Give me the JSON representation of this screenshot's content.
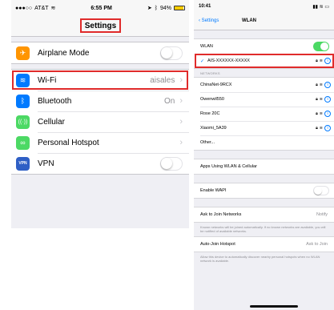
{
  "left": {
    "status": {
      "carrier": "AT&T",
      "signal_dots": "●●●○○",
      "time": "6:55 PM",
      "battery": "94%"
    },
    "nav_title": "Settings",
    "group1": [
      {
        "label": "Airplane Mode",
        "icon": "airplane-icon",
        "color": "#ff9500",
        "glyph": "✈"
      }
    ],
    "group2": [
      {
        "label": "Wi-Fi",
        "value": "aisales",
        "icon": "wifi-icon",
        "color": "#007aff",
        "glyph": "≋"
      },
      {
        "label": "Bluetooth",
        "value": "On",
        "icon": "bluetooth-icon",
        "color": "#007aff",
        "glyph": "ᛒ"
      },
      {
        "label": "Cellular",
        "icon": "cellular-icon",
        "color": "#4cd964",
        "glyph": "((·))"
      },
      {
        "label": "Personal Hotspot",
        "icon": "hotspot-icon",
        "color": "#4cd964",
        "glyph": "∞"
      },
      {
        "label": "VPN",
        "icon": "vpn-icon",
        "color": "#2f5fc5",
        "glyph": "VPN"
      }
    ]
  },
  "right": {
    "status": {
      "time": "10:41"
    },
    "back_label": "Settings",
    "nav_title": "WLAN",
    "wlan_label": "WLAN",
    "connected_network": "AIS-XXXXXX-XXXXX",
    "networks_header": "NETWORKS",
    "networks": [
      "ChinaNet-9RCX",
      "Owenwil550",
      "Rose 20C",
      "Xiaomi_5A39",
      "Other..."
    ],
    "apps_label": "Apps Using WLAN & Cellular",
    "wapi_label": "Enable WAPI",
    "ask_label": "Ask to Join Networks",
    "ask_value": "Notify",
    "ask_desc": "Known networks will be joined automatically. If no known networks are available, you will be notified of available networks.",
    "auto_label": "Auto-Join Hotspot",
    "auto_value": "Ask to Join",
    "auto_desc": "Allow this device to automatically discover nearby personal hotspots when no WLAN network is available."
  },
  "colors": {
    "highlight": "#e02b2b",
    "ios_blue": "#007aff",
    "toggle_green": "#4cd964"
  }
}
